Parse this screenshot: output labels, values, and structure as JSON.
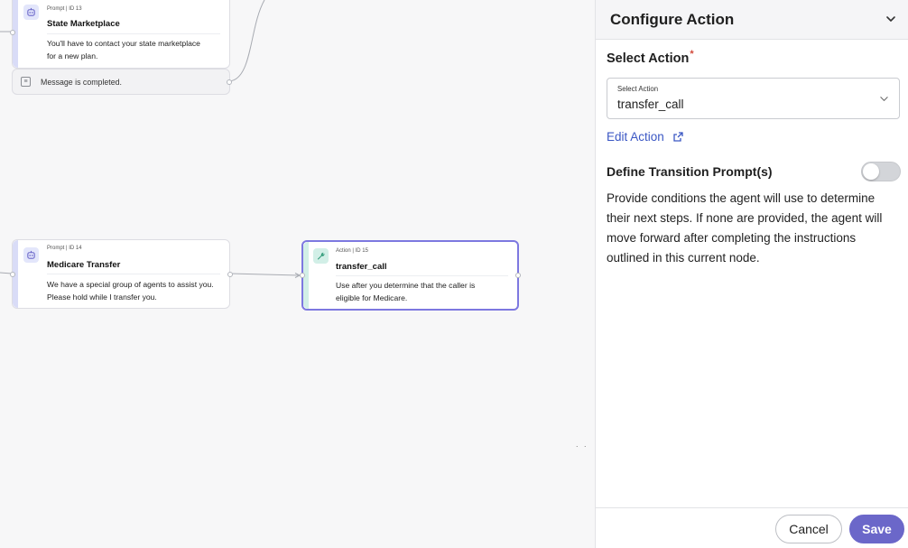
{
  "canvas": {
    "nodes": [
      {
        "id": "node-13",
        "meta": "Prompt | ID 13",
        "title": "State Marketplace",
        "text_lines": [
          "You'll have to contact your state marketplace",
          "for a new plan."
        ],
        "icon": "robot-icon"
      },
      {
        "id": "node-14",
        "meta": "Prompt | ID 14",
        "title": "Medicare Transfer",
        "text_lines": [
          "We have a special group of agents to assist you.",
          "Please hold while I transfer you."
        ],
        "icon": "robot-icon"
      },
      {
        "id": "node-15",
        "meta": "Action | ID 15",
        "title": "transfer_call",
        "text_lines": [
          "Use after you determine that the caller is",
          "eligible for Medicare."
        ],
        "icon": "wrench-icon"
      }
    ],
    "message_bar": {
      "text": "Message is completed.",
      "icon": "message-icon"
    },
    "dots": ". ."
  },
  "panel": {
    "title": "Configure Action",
    "select_action": {
      "label": "Select Action",
      "required_mark": "*",
      "field_label": "Select Action",
      "value": "transfer_call"
    },
    "edit_action": {
      "label": "Edit Action",
      "icon": "external-link-icon"
    },
    "transition": {
      "label": "Define Transition Prompt(s)",
      "enabled": false,
      "description": "Provide conditions the agent will use to determine their next steps. If none are provided, the agent will move forward after completing the instructions outlined in this current node."
    },
    "buttons": {
      "cancel": "Cancel",
      "save": "Save"
    }
  },
  "colors": {
    "accent": "#6b67c9",
    "link": "#3b57c4",
    "prompt_bar": "#d9dcf7",
    "action_bar": "#d2efe7",
    "action_border": "#7d78e0",
    "required": "#d24a3b"
  }
}
